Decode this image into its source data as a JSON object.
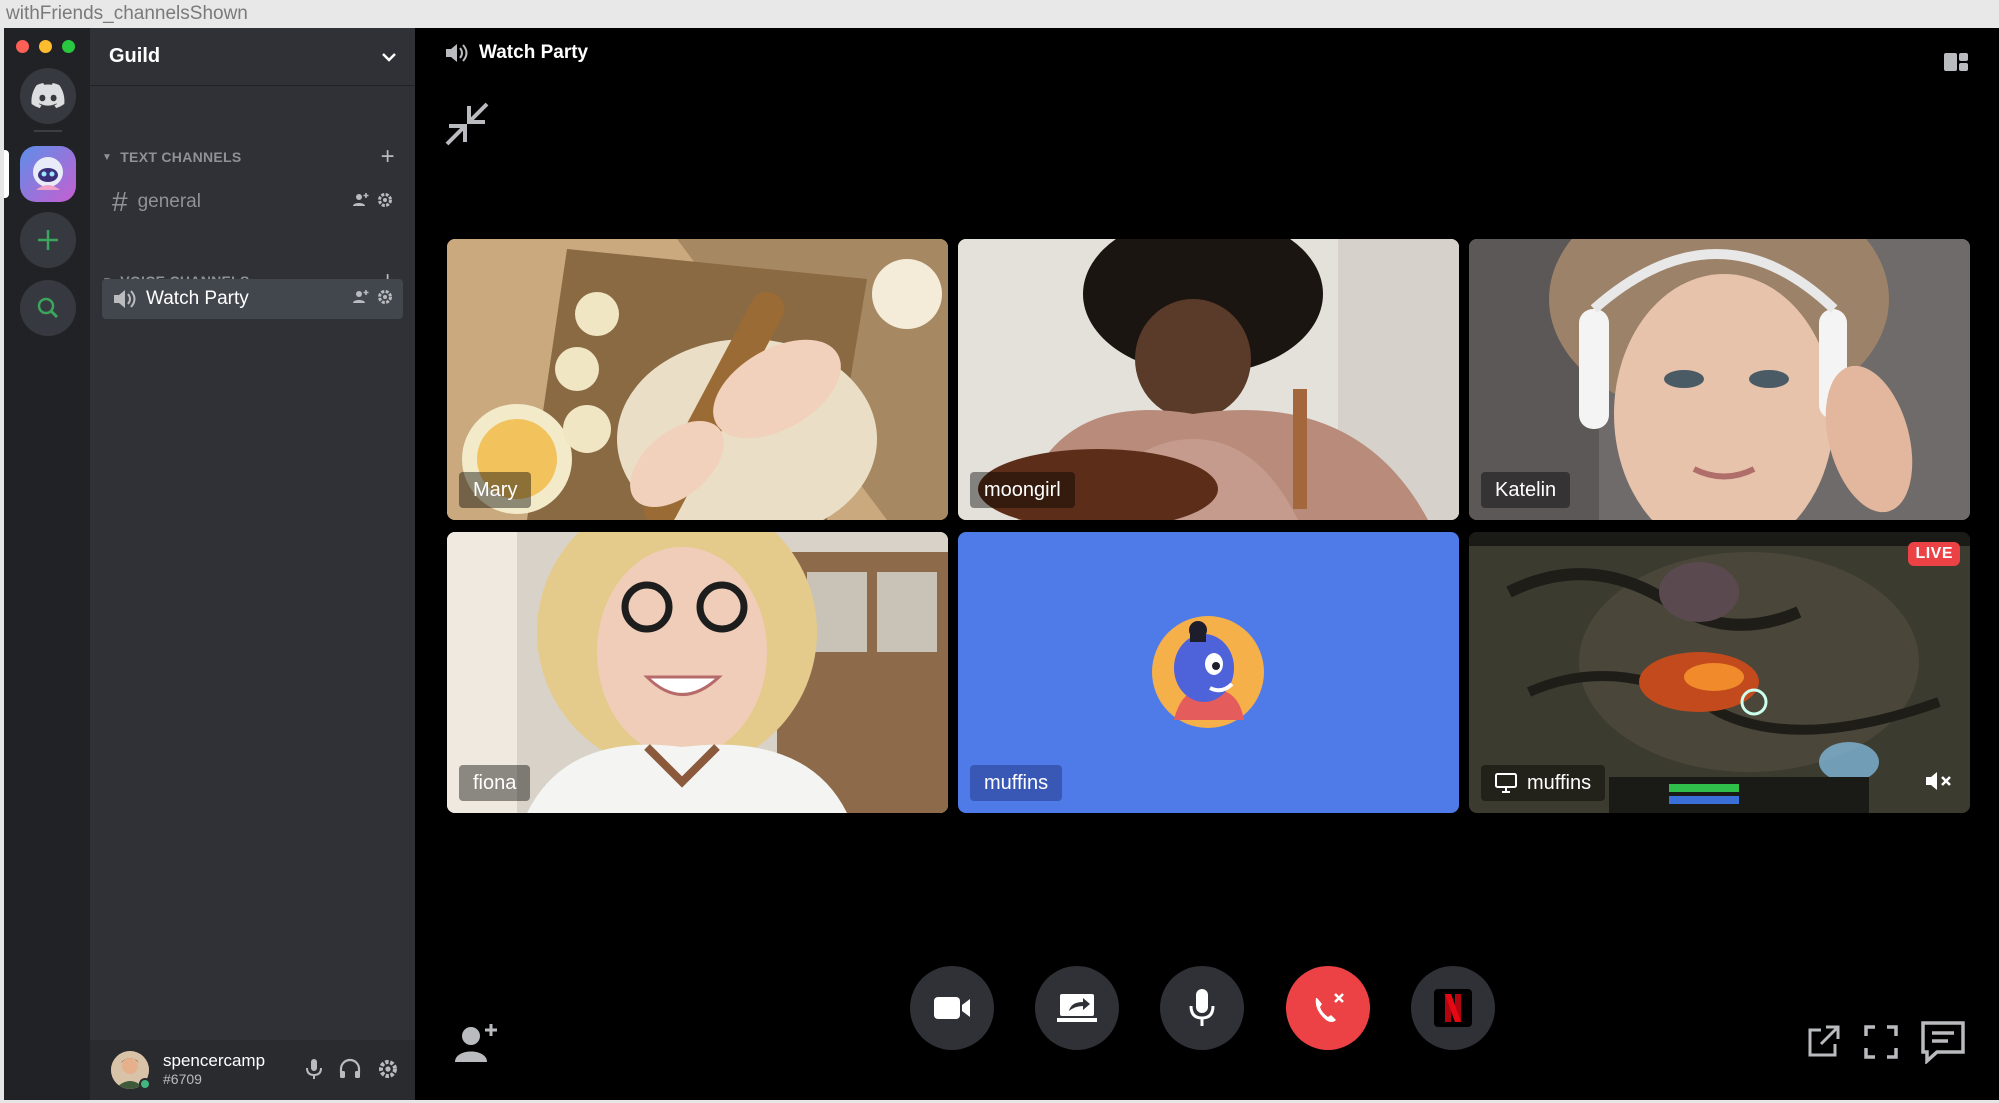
{
  "window": {
    "caption": "withFriends_channelsShown"
  },
  "colors": {
    "online": "#43b581",
    "danger": "#ed4245",
    "blurple": "#4f7be8",
    "netflix": "#e50914"
  },
  "guild": {
    "name": "Guild"
  },
  "categories": {
    "text": {
      "label": "TEXT CHANNELS"
    },
    "voice": {
      "label": "VOICE CHANNELS"
    }
  },
  "channels": {
    "text": [
      {
        "name": "general"
      }
    ],
    "voice": [
      {
        "name": "Watch Party",
        "selected": true
      }
    ]
  },
  "user": {
    "name": "spencercamp",
    "tag": "#6709"
  },
  "call": {
    "title": "Watch Party",
    "participants": [
      {
        "name": "Mary",
        "kind": "video"
      },
      {
        "name": "moongirl",
        "kind": "video"
      },
      {
        "name": "Katelin",
        "kind": "video"
      },
      {
        "name": "fiona",
        "kind": "video"
      },
      {
        "name": "muffins",
        "kind": "avatar"
      },
      {
        "name": "muffins",
        "kind": "stream",
        "badge": "LIVE"
      }
    ]
  },
  "icons": {
    "rail": [
      "discord-home-icon",
      "guild-avatar-icon",
      "add-server-icon",
      "explore-icon"
    ],
    "controls": [
      "camera-icon",
      "screen-share-icon",
      "microphone-icon",
      "disconnect-icon",
      "netflix-activity-icon"
    ]
  }
}
